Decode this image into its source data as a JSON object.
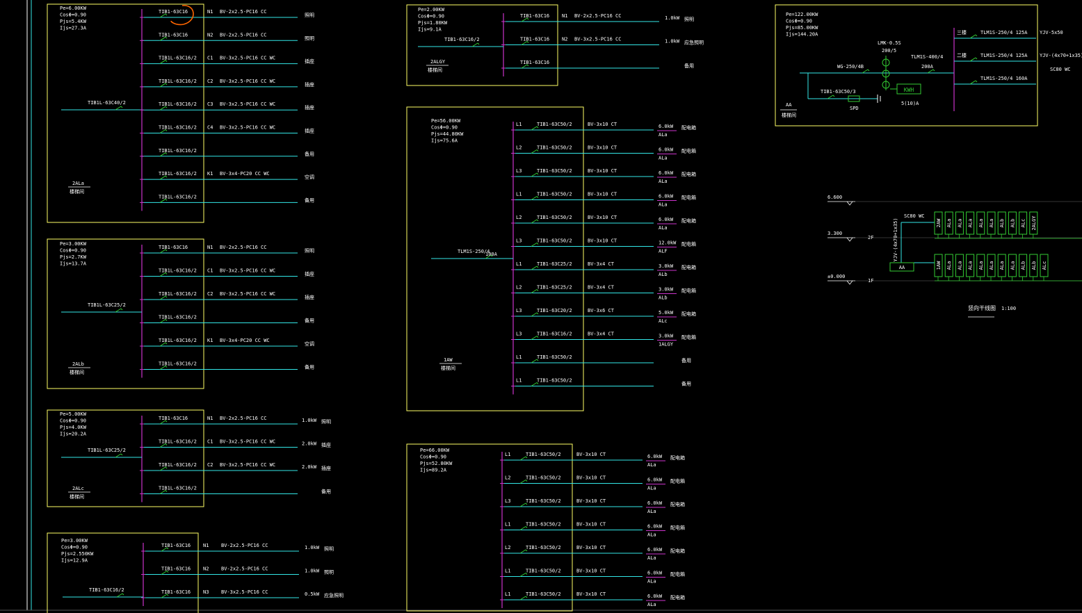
{
  "colors": {
    "background": "#000000",
    "panel_border": "#ffff66",
    "feeder_line": "#33e8e8",
    "bus_bar": "#cc33cc",
    "breaker": "#33cc33",
    "text": "#ffffff",
    "annotation_circle": "#ff6600",
    "riser_box": "#33cc33"
  },
  "panels": [
    {
      "id": "2ALa",
      "summary": [
        "Pe=6.00KW",
        "CosΦ=0.90",
        "Pjs=5.4KW",
        "Ijs=27.3A"
      ],
      "incoming": "TIB1L-63C40/2",
      "name": "2ALa",
      "location": "楼梯间",
      "feeders": [
        {
          "breaker": "TIB1-63C16",
          "circuit": "N1",
          "cable": "BV-2x2.5-PC16 CC",
          "load": "",
          "use": "照明"
        },
        {
          "breaker": "TIB1-63C16",
          "circuit": "N2",
          "cable": "BV-2x2.5-PC16 CC",
          "load": "",
          "use": "照明"
        },
        {
          "breaker": "TIB1L-63C16/2",
          "circuit": "C1",
          "cable": "BV-3x2.5-PC16 CC WC",
          "load": "",
          "use": "插座"
        },
        {
          "breaker": "TIB1L-63C16/2",
          "circuit": "C2",
          "cable": "BV-3x2.5-PC16 CC WC",
          "load": "",
          "use": "插座"
        },
        {
          "breaker": "TIB1L-63C16/2",
          "circuit": "C3",
          "cable": "BV-3x2.5-PC16 CC WC",
          "load": "",
          "use": "插座"
        },
        {
          "breaker": "TIB1L-63C16/2",
          "circuit": "C4",
          "cable": "BV-3x2.5-PC16 CC WC",
          "load": "",
          "use": "插座"
        },
        {
          "breaker": "TIB1L-63C16/2",
          "circuit": "",
          "cable": "",
          "load": "",
          "use": "备用"
        },
        {
          "breaker": "TIB1L-63C16/2",
          "circuit": "K1",
          "cable": "BV-3x4-PC20 CC WC",
          "load": "",
          "use": "空调"
        },
        {
          "breaker": "TIB1L-63C16/2",
          "circuit": "",
          "cable": "",
          "load": "",
          "use": "备用"
        }
      ]
    },
    {
      "id": "2ALb",
      "summary": [
        "Pe=3.00KW",
        "CosΦ=0.90",
        "Pjs=2.7KW",
        "Ijs=13.7A"
      ],
      "incoming": "TIB1L-63C25/2",
      "name": "2ALb",
      "location": "楼梯间",
      "feeders": [
        {
          "breaker": "TIB1-63C16",
          "circuit": "N1",
          "cable": "BV-2x2.5-PC16 CC",
          "load": "",
          "use": "照明"
        },
        {
          "breaker": "TIB1L-63C16/2",
          "circuit": "C1",
          "cable": "BV-3x2.5-PC16 CC WC",
          "load": "",
          "use": "插座"
        },
        {
          "breaker": "TIB1L-63C16/2",
          "circuit": "C2",
          "cable": "BV-3x2.5-PC16 CC WC",
          "load": "",
          "use": "插座"
        },
        {
          "breaker": "TIB1L-63C16/2",
          "circuit": "",
          "cable": "",
          "load": "",
          "use": "备用"
        },
        {
          "breaker": "TIB1L-63C16/2",
          "circuit": "K1",
          "cable": "BV-3x4-PC20 CC WC",
          "load": "",
          "use": "空调"
        },
        {
          "breaker": "TIB1L-63C16/2",
          "circuit": "",
          "cable": "",
          "load": "",
          "use": "备用"
        }
      ]
    },
    {
      "id": "2ALc",
      "summary": [
        "Pe=5.00KW",
        "CosΦ=0.90",
        "Pjs=4.0KW",
        "Ijs=20.2A"
      ],
      "incoming": "TIB1L-63C25/2",
      "name": "2ALc",
      "location": "楼梯间",
      "feeders": [
        {
          "breaker": "TIB1-63C16",
          "circuit": "N1",
          "cable": "BV-2x2.5-PC16 CC",
          "load": "1.0kW",
          "use": "照明"
        },
        {
          "breaker": "TIB1L-63C16/2",
          "circuit": "C1",
          "cable": "BV-3x2.5-PC16 CC WC",
          "load": "2.0kW",
          "use": "插座"
        },
        {
          "breaker": "TIB1L-63C16/2",
          "circuit": "C2",
          "cable": "BV-3x2.5-PC16 CC WC",
          "load": "2.0kW",
          "use": "插座"
        },
        {
          "breaker": "TIB1L-63C16/2",
          "circuit": "",
          "cable": "",
          "load": "",
          "use": "备用"
        }
      ]
    },
    {
      "id": "bottom-left",
      "summary": [
        "Pe=3.00KW",
        "CosΦ=0.90",
        "Pjs=2.550KW",
        "Ijs=12.9A"
      ],
      "incoming": "TIB1-63C16/2",
      "name": "",
      "location": "",
      "feeders": [
        {
          "breaker": "TIB1-63C16",
          "circuit": "N1",
          "cable": "BV-2x2.5-PC16 CC",
          "load": "1.0kW",
          "use": "照明"
        },
        {
          "breaker": "TIB1-63C16",
          "circuit": "N2",
          "cable": "BV-2x2.5-PC16 CC",
          "load": "1.0kW",
          "use": "照明"
        },
        {
          "breaker": "TIB1-63C16",
          "circuit": "N3",
          "cable": "BV-3x2.5-PC16 CC",
          "load": "0.5kW",
          "use": "应急照明"
        }
      ]
    },
    {
      "id": "2ALGY",
      "summary": [
        "Pe=2.00KW",
        "CosΦ=0.90",
        "Pjs=1.80KW",
        "Ijs=9.1A"
      ],
      "incoming": "TIB1-63C16/2",
      "name": "2ALGY",
      "location": "楼梯间",
      "feeders": [
        {
          "breaker": "TIB1-63C16",
          "circuit": "N1",
          "cable": "BV-2x2.5-PC16 CC",
          "load": "1.0kW",
          "use": "照明"
        },
        {
          "breaker": "TIB1-63C16",
          "circuit": "N2",
          "cable": "BV-3x2.5-PC16 CC",
          "load": "1.0kW",
          "use": "应急照明"
        },
        {
          "breaker": "TIB1-63C16",
          "circuit": "",
          "cable": "",
          "load": "",
          "use": "备用"
        }
      ]
    },
    {
      "id": "1AW",
      "summary": [
        "Pe=56.00KW",
        "CosΦ=0.90",
        "Pjs=44.80KW",
        "Ijs=75.6A"
      ],
      "incoming": "TLM1S-250/4",
      "incoming_rating": "100A",
      "name": "1AW",
      "location": "楼梯间",
      "feeders": [
        {
          "breaker": "TIB1-63C50/2",
          "circuit": "L1",
          "cable": "BV-3x10 CT",
          "load": "6.0kW",
          "dest": "ALa",
          "use": "配电箱"
        },
        {
          "breaker": "TIB1-63C50/2",
          "circuit": "L2",
          "cable": "BV-3x10 CT",
          "load": "6.0kW",
          "dest": "ALa",
          "use": "配电箱"
        },
        {
          "breaker": "TIB1-63C50/2",
          "circuit": "L3",
          "cable": "BV-3x10 CT",
          "load": "6.0kW",
          "dest": "ALa",
          "use": "配电箱"
        },
        {
          "breaker": "TIB1-63C50/2",
          "circuit": "L1",
          "cable": "BV-3x10 CT",
          "load": "6.0kW",
          "dest": "ALa",
          "use": "配电箱"
        },
        {
          "breaker": "TIB1-63C50/2",
          "circuit": "L2",
          "cable": "BV-3x10 CT",
          "load": "6.0kW",
          "dest": "ALa",
          "use": "配电箱"
        },
        {
          "breaker": "TIB1-63C50/2",
          "circuit": "L3",
          "cable": "BV-3x10 CT",
          "load": "12.0kW",
          "dest": "ALF",
          "use": "配电箱"
        },
        {
          "breaker": "TIB1-63C25/2",
          "circuit": "L1",
          "cable": "BV-3x4 CT",
          "load": "3.0kW",
          "dest": "ALb",
          "use": "配电箱"
        },
        {
          "breaker": "TIB1-63C25/2",
          "circuit": "L2",
          "cable": "BV-3x4 CT",
          "load": "3.0kW",
          "dest": "ALb",
          "use": "配电箱"
        },
        {
          "breaker": "TIB1-63C20/2",
          "circuit": "L3",
          "cable": "BV-3x6 CT",
          "load": "5.0kW",
          "dest": "ALc",
          "use": "配电箱"
        },
        {
          "breaker": "TIB1-63C16/2",
          "circuit": "L3",
          "cable": "BV-3x4 CT",
          "load": "3.0kW",
          "dest": "1ALGY",
          "use": "配电箱"
        },
        {
          "breaker": "TIB1-63C50/2",
          "circuit": "L1",
          "cable": "",
          "load": "",
          "dest": "",
          "use": "备用"
        },
        {
          "breaker": "TIB1-63C50/2",
          "circuit": "L1",
          "cable": "",
          "load": "",
          "dest": "",
          "use": "备用"
        }
      ]
    },
    {
      "id": "2AW",
      "summary": [
        "Pe=66.00KW",
        "CosΦ=0.90",
        "Pjs=52.80KW",
        "Ijs=89.2A"
      ],
      "incoming": "",
      "name": "",
      "location": "",
      "feeders": [
        {
          "breaker": "TIB1-63C50/2",
          "circuit": "L1",
          "cable": "BV-3x10 CT",
          "load": "6.0kW",
          "dest": "ALa",
          "use": "配电箱"
        },
        {
          "breaker": "TIB1-63C50/2",
          "circuit": "L2",
          "cable": "BV-3x10 CT",
          "load": "6.0kW",
          "dest": "ALa",
          "use": "配电箱"
        },
        {
          "breaker": "TIB1-63C50/2",
          "circuit": "L3",
          "cable": "BV-3x10 CT",
          "load": "6.0kW",
          "dest": "ALa",
          "use": "配电箱"
        },
        {
          "breaker": "TIB1-63C50/2",
          "circuit": "L1",
          "cable": "BV-3x10 CT",
          "load": "6.0kW",
          "dest": "ALa",
          "use": "配电箱"
        },
        {
          "breaker": "TIB1-63C50/2",
          "circuit": "L2",
          "cable": "BV-3x10 CT",
          "load": "6.0kW",
          "dest": "ALa",
          "use": "配电箱"
        },
        {
          "breaker": "TIB1-63C50/2",
          "circuit": "L1",
          "cable": "BV-3x10 CT",
          "load": "6.0kW",
          "dest": "ALa",
          "use": "配电箱"
        },
        {
          "breaker": "TIB1-63C50/2",
          "circuit": "L1",
          "cable": "BV-3x10 CT",
          "load": "6.0kW",
          "dest": "ALa",
          "use": "配电箱"
        }
      ]
    }
  ],
  "main_panel": {
    "summary": [
      "Pe=122.00KW",
      "CosΦ=0.90",
      "Pjs=85.00KW",
      "Ijs=144.20A"
    ],
    "name": "AA",
    "location": "楼梯间",
    "switch": "WG-250/4B",
    "ct": "LMK-0.5S",
    "ct_ratio": "200/5",
    "meter": "KWH",
    "meter_rating": "5(10)A",
    "main_breaker": "TLM1S-400/4",
    "main_rating": "200A",
    "spd_breaker": "TIB1-63C50/3",
    "spd": "SPD",
    "outgoing": [
      {
        "breaker": "TLM1S-250/4 125A",
        "label": "三楼",
        "cable": "YJV-5x50"
      },
      {
        "breaker": "TLM1S-250/4 125A",
        "label": "二楼",
        "cable": "YJV-(4x70+1x35)"
      },
      {
        "breaker": "TLM1S-250/4 160A",
        "label": "",
        "cable": ""
      }
    ],
    "conduit": "SC80 WC"
  },
  "riser": {
    "levels": [
      "6.600",
      "3.300",
      "±0.000"
    ],
    "floor_labels": [
      "",
      "2F",
      "1F"
    ],
    "conduit": "SC80 WC",
    "cable": "YJV-(4x70+1x35)",
    "main_box": "AA",
    "upper_boxes": [
      "2AW",
      "ALa",
      "ALa",
      "ALa",
      "ALa",
      "ALa",
      "ALb",
      "ALb",
      "ALc",
      "2ALGY"
    ],
    "lower_boxes": [
      "1AW",
      "ALa",
      "ALa",
      "ALa",
      "ALa",
      "ALa",
      "ALa",
      "ALa",
      "ALb",
      "ALb",
      "ALc"
    ],
    "title": "竖向干线图",
    "scale": "1:100"
  }
}
